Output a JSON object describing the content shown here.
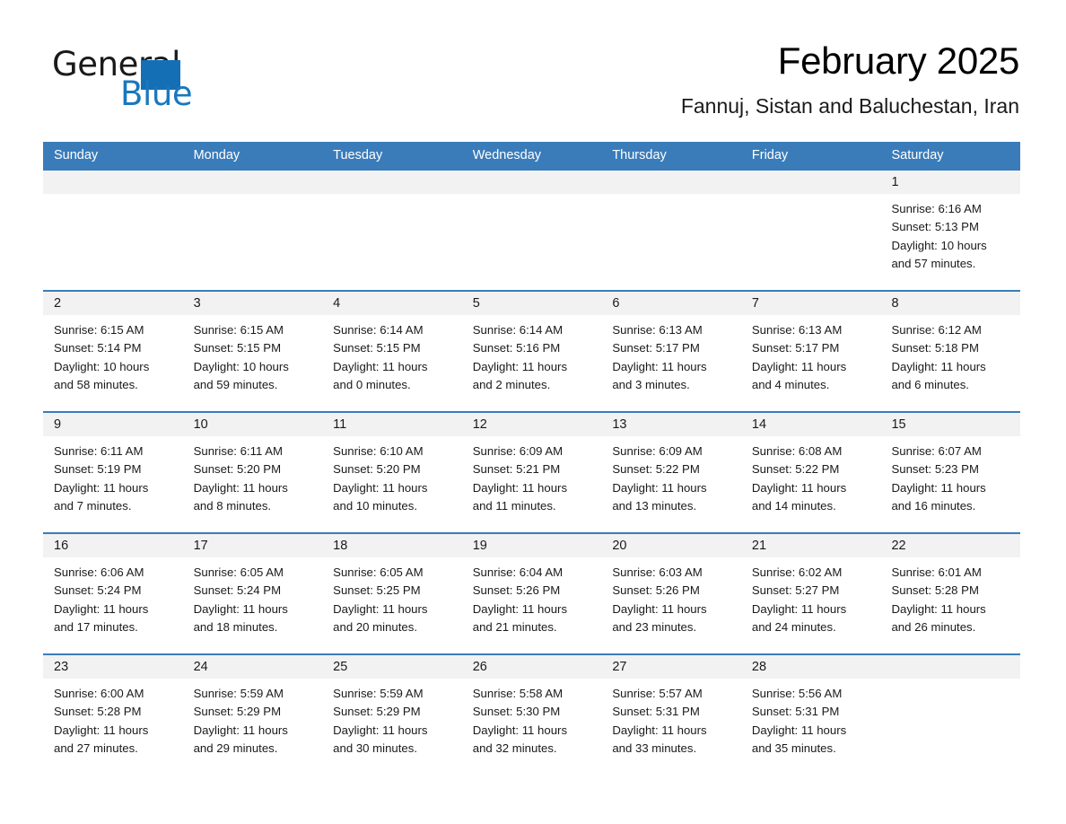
{
  "brand": {
    "name_part1": "General",
    "name_part2": "Blue",
    "accent_color": "#1878be",
    "triangle_color": "#156fb4"
  },
  "header": {
    "month_title": "February 2025",
    "location": "Fannuj, Sistan and Baluchestan, Iran"
  },
  "calendar": {
    "header_bg": "#3a7cba",
    "date_band_bg": "#f2f2f2",
    "weekdays": [
      "Sunday",
      "Monday",
      "Tuesday",
      "Wednesday",
      "Thursday",
      "Friday",
      "Saturday"
    ],
    "weeks": [
      [
        {
          "date": "",
          "sunrise": "",
          "sunset": "",
          "daylight": "",
          "daylight2": ""
        },
        {
          "date": "",
          "sunrise": "",
          "sunset": "",
          "daylight": "",
          "daylight2": ""
        },
        {
          "date": "",
          "sunrise": "",
          "sunset": "",
          "daylight": "",
          "daylight2": ""
        },
        {
          "date": "",
          "sunrise": "",
          "sunset": "",
          "daylight": "",
          "daylight2": ""
        },
        {
          "date": "",
          "sunrise": "",
          "sunset": "",
          "daylight": "",
          "daylight2": ""
        },
        {
          "date": "",
          "sunrise": "",
          "sunset": "",
          "daylight": "",
          "daylight2": ""
        },
        {
          "date": "1",
          "sunrise": "Sunrise: 6:16 AM",
          "sunset": "Sunset: 5:13 PM",
          "daylight": "Daylight: 10 hours",
          "daylight2": "and 57 minutes."
        }
      ],
      [
        {
          "date": "2",
          "sunrise": "Sunrise: 6:15 AM",
          "sunset": "Sunset: 5:14 PM",
          "daylight": "Daylight: 10 hours",
          "daylight2": "and 58 minutes."
        },
        {
          "date": "3",
          "sunrise": "Sunrise: 6:15 AM",
          "sunset": "Sunset: 5:15 PM",
          "daylight": "Daylight: 10 hours",
          "daylight2": "and 59 minutes."
        },
        {
          "date": "4",
          "sunrise": "Sunrise: 6:14 AM",
          "sunset": "Sunset: 5:15 PM",
          "daylight": "Daylight: 11 hours",
          "daylight2": "and 0 minutes."
        },
        {
          "date": "5",
          "sunrise": "Sunrise: 6:14 AM",
          "sunset": "Sunset: 5:16 PM",
          "daylight": "Daylight: 11 hours",
          "daylight2": "and 2 minutes."
        },
        {
          "date": "6",
          "sunrise": "Sunrise: 6:13 AM",
          "sunset": "Sunset: 5:17 PM",
          "daylight": "Daylight: 11 hours",
          "daylight2": "and 3 minutes."
        },
        {
          "date": "7",
          "sunrise": "Sunrise: 6:13 AM",
          "sunset": "Sunset: 5:17 PM",
          "daylight": "Daylight: 11 hours",
          "daylight2": "and 4 minutes."
        },
        {
          "date": "8",
          "sunrise": "Sunrise: 6:12 AM",
          "sunset": "Sunset: 5:18 PM",
          "daylight": "Daylight: 11 hours",
          "daylight2": "and 6 minutes."
        }
      ],
      [
        {
          "date": "9",
          "sunrise": "Sunrise: 6:11 AM",
          "sunset": "Sunset: 5:19 PM",
          "daylight": "Daylight: 11 hours",
          "daylight2": "and 7 minutes."
        },
        {
          "date": "10",
          "sunrise": "Sunrise: 6:11 AM",
          "sunset": "Sunset: 5:20 PM",
          "daylight": "Daylight: 11 hours",
          "daylight2": "and 8 minutes."
        },
        {
          "date": "11",
          "sunrise": "Sunrise: 6:10 AM",
          "sunset": "Sunset: 5:20 PM",
          "daylight": "Daylight: 11 hours",
          "daylight2": "and 10 minutes."
        },
        {
          "date": "12",
          "sunrise": "Sunrise: 6:09 AM",
          "sunset": "Sunset: 5:21 PM",
          "daylight": "Daylight: 11 hours",
          "daylight2": "and 11 minutes."
        },
        {
          "date": "13",
          "sunrise": "Sunrise: 6:09 AM",
          "sunset": "Sunset: 5:22 PM",
          "daylight": "Daylight: 11 hours",
          "daylight2": "and 13 minutes."
        },
        {
          "date": "14",
          "sunrise": "Sunrise: 6:08 AM",
          "sunset": "Sunset: 5:22 PM",
          "daylight": "Daylight: 11 hours",
          "daylight2": "and 14 minutes."
        },
        {
          "date": "15",
          "sunrise": "Sunrise: 6:07 AM",
          "sunset": "Sunset: 5:23 PM",
          "daylight": "Daylight: 11 hours",
          "daylight2": "and 16 minutes."
        }
      ],
      [
        {
          "date": "16",
          "sunrise": "Sunrise: 6:06 AM",
          "sunset": "Sunset: 5:24 PM",
          "daylight": "Daylight: 11 hours",
          "daylight2": "and 17 minutes."
        },
        {
          "date": "17",
          "sunrise": "Sunrise: 6:05 AM",
          "sunset": "Sunset: 5:24 PM",
          "daylight": "Daylight: 11 hours",
          "daylight2": "and 18 minutes."
        },
        {
          "date": "18",
          "sunrise": "Sunrise: 6:05 AM",
          "sunset": "Sunset: 5:25 PM",
          "daylight": "Daylight: 11 hours",
          "daylight2": "and 20 minutes."
        },
        {
          "date": "19",
          "sunrise": "Sunrise: 6:04 AM",
          "sunset": "Sunset: 5:26 PM",
          "daylight": "Daylight: 11 hours",
          "daylight2": "and 21 minutes."
        },
        {
          "date": "20",
          "sunrise": "Sunrise: 6:03 AM",
          "sunset": "Sunset: 5:26 PM",
          "daylight": "Daylight: 11 hours",
          "daylight2": "and 23 minutes."
        },
        {
          "date": "21",
          "sunrise": "Sunrise: 6:02 AM",
          "sunset": "Sunset: 5:27 PM",
          "daylight": "Daylight: 11 hours",
          "daylight2": "and 24 minutes."
        },
        {
          "date": "22",
          "sunrise": "Sunrise: 6:01 AM",
          "sunset": "Sunset: 5:28 PM",
          "daylight": "Daylight: 11 hours",
          "daylight2": "and 26 minutes."
        }
      ],
      [
        {
          "date": "23",
          "sunrise": "Sunrise: 6:00 AM",
          "sunset": "Sunset: 5:28 PM",
          "daylight": "Daylight: 11 hours",
          "daylight2": "and 27 minutes."
        },
        {
          "date": "24",
          "sunrise": "Sunrise: 5:59 AM",
          "sunset": "Sunset: 5:29 PM",
          "daylight": "Daylight: 11 hours",
          "daylight2": "and 29 minutes."
        },
        {
          "date": "25",
          "sunrise": "Sunrise: 5:59 AM",
          "sunset": "Sunset: 5:29 PM",
          "daylight": "Daylight: 11 hours",
          "daylight2": "and 30 minutes."
        },
        {
          "date": "26",
          "sunrise": "Sunrise: 5:58 AM",
          "sunset": "Sunset: 5:30 PM",
          "daylight": "Daylight: 11 hours",
          "daylight2": "and 32 minutes."
        },
        {
          "date": "27",
          "sunrise": "Sunrise: 5:57 AM",
          "sunset": "Sunset: 5:31 PM",
          "daylight": "Daylight: 11 hours",
          "daylight2": "and 33 minutes."
        },
        {
          "date": "28",
          "sunrise": "Sunrise: 5:56 AM",
          "sunset": "Sunset: 5:31 PM",
          "daylight": "Daylight: 11 hours",
          "daylight2": "and 35 minutes."
        },
        {
          "date": "",
          "sunrise": "",
          "sunset": "",
          "daylight": "",
          "daylight2": ""
        }
      ]
    ]
  }
}
